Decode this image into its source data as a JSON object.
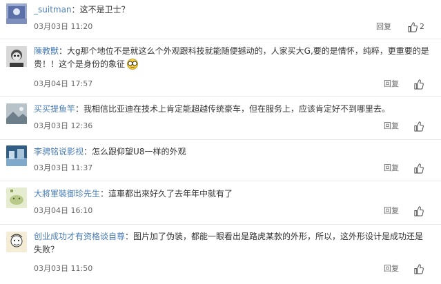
{
  "comments": [
    {
      "user": "_suitman",
      "separator": "：",
      "text": "这不是卫士？",
      "time": "03月03日 11:20",
      "reply_label": "回复",
      "like_count": "2",
      "avatar_color": "#5b6fa8"
    },
    {
      "user": "陳教獸",
      "separator": "：",
      "text": "大g那个地位不是就这么个外观跟科技就能随便撼动的，人家买大G,要的是情怀，纯粹，更重要的是贵！！这个是身份的象征",
      "emoji": "glasses-emoji",
      "time": "03月04日 17:57",
      "reply_label": "回复",
      "like_count": "",
      "avatar_color": "#3b3b3b"
    },
    {
      "user": "买买提鱼竿",
      "separator": "：",
      "text": "我相信比亚迪在技术上肯定能超越传统豪车，但在服务上，应该肯定好不到哪里去。",
      "time": "03月03日 12:36",
      "reply_label": "回复",
      "like_count": "",
      "avatar_color": "#6e7f8c"
    },
    {
      "user": "李骋铭说影视",
      "separator": "：",
      "text": "怎么跟仰望U8一样的外观",
      "time": "03月03日 11:37",
      "reply_label": "回复",
      "like_count": "",
      "avatar_color": "#4d7aa3"
    },
    {
      "user": "大將軍裝御珍先生",
      "separator": "：",
      "text": "這車都出來好久了去年年中就有了",
      "time": "03月04日 16:10",
      "reply_label": "回复",
      "like_count": "",
      "avatar_color": "#c9d6a0"
    },
    {
      "user": "创业成功才有资格谈自尊",
      "separator": "：",
      "text": "图片加了伪装，都能一眼看出是路虎某款的外形，所以，这外形设计是成功还是失败？",
      "time": "03月03日 11:50",
      "reply_label": "回复",
      "like_count": "",
      "avatar_color": "#f0e2c0"
    }
  ],
  "colors": {
    "username": "#4a7db5",
    "text": "#333333",
    "meta": "#666666",
    "divider": "#e8e8e8"
  }
}
